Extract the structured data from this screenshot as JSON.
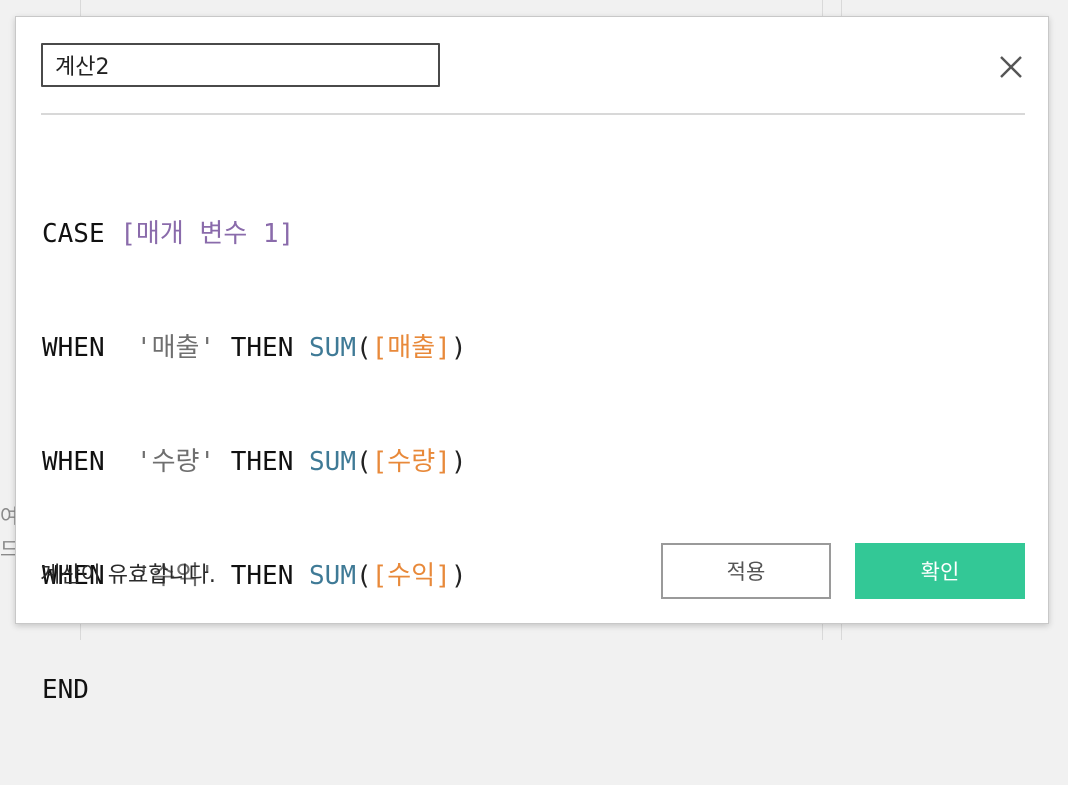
{
  "dialog": {
    "calc_name": "계산2",
    "close_icon": "close-icon",
    "status_text": "계산이 유효합니다.",
    "apply_label": "적용",
    "ok_label": "확인"
  },
  "code": {
    "line1": {
      "kw": "CASE",
      "param": "[매개 변수 1]"
    },
    "line2": {
      "kw": "WHEN",
      "str": "'매출'",
      "then": "THEN",
      "fn": "SUM",
      "open": "(",
      "field": "[매출]",
      "close": ")"
    },
    "line3": {
      "kw": "WHEN",
      "str": "'수량'",
      "then": "THEN",
      "fn": "SUM",
      "open": "(",
      "field": "[수량]",
      "close": ")"
    },
    "line4": {
      "kw": "WHEN",
      "str": "'수익'",
      "then": "THEN",
      "fn": "SUM",
      "open": "(",
      "field": "[수익]",
      "close": ")"
    },
    "line5": {
      "kw": "END"
    }
  },
  "background": {
    "fragment_1": "여",
    "fragment_2": "드"
  },
  "colors": {
    "keyword": "#111111",
    "parameter": "#8a6bab",
    "string": "#6f6f6f",
    "function": "#3f7a96",
    "field": "#e8893a",
    "ok_button": "#33c896"
  }
}
